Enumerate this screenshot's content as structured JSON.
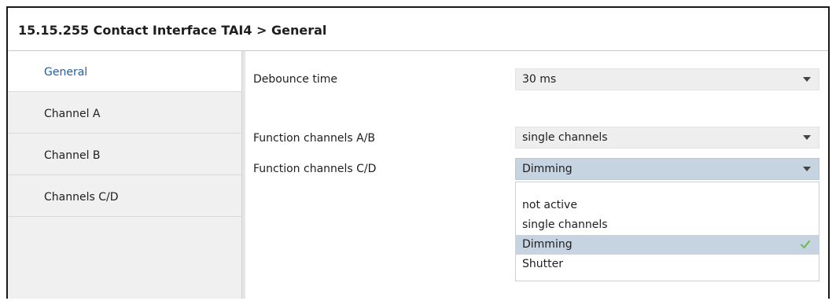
{
  "window": {
    "title": "15.15.255 Contact Interface TAI4 > General"
  },
  "sidebar": {
    "items": [
      {
        "label": "General",
        "active": true
      },
      {
        "label": "Channel  A",
        "active": false
      },
      {
        "label": "Channel  B",
        "active": false
      },
      {
        "label": "Channels  C/D",
        "active": false
      }
    ]
  },
  "params": {
    "debounce": {
      "label": "Debounce time",
      "value": "30 ms"
    },
    "function_ab": {
      "label": "Function channels A/B",
      "value": "single channels"
    },
    "function_cd": {
      "label": "Function channels C/D",
      "value": "Dimming",
      "open": true
    }
  },
  "dropdown": {
    "options": [
      {
        "label": "not active"
      },
      {
        "label": "single channels"
      },
      {
        "label": "Dimming",
        "selected": true,
        "icon": "check-icon"
      },
      {
        "label": "Shutter"
      }
    ]
  },
  "colors": {
    "active_nav_text": "#1f5fa6",
    "selected_option_bg": "#c5d4e0",
    "check": "#6fbf5a"
  }
}
